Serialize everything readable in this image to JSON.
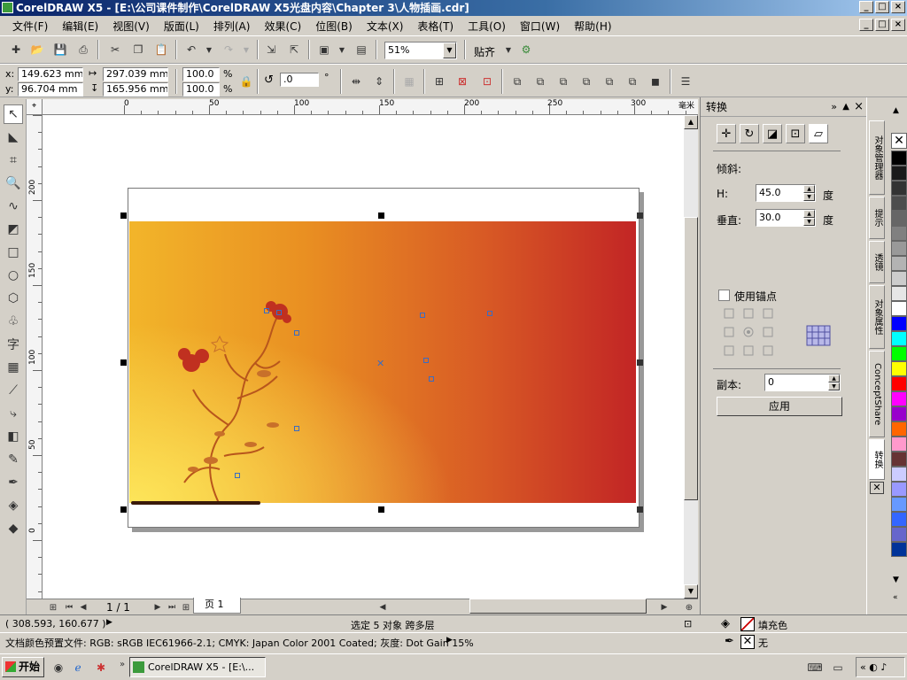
{
  "window": {
    "title": "CorelDRAW X5 - [E:\\公司课件制作\\CorelDRAW X5光盘内容\\Chapter 3\\人物插画.cdr]",
    "min": "_",
    "max": "□",
    "close": "×"
  },
  "menu": [
    "文件(F)",
    "编辑(E)",
    "视图(V)",
    "版面(L)",
    "排列(A)",
    "效果(C)",
    "位图(B)",
    "文本(X)",
    "表格(T)",
    "工具(O)",
    "窗口(W)",
    "帮助(H)"
  ],
  "toolbar": {
    "zoom": "51%",
    "snap_label": "贴齐"
  },
  "props": {
    "x_label": "x:",
    "x": "149.623 mm",
    "y_label": "y:",
    "y": "96.704 mm",
    "w": "297.039 mm",
    "h": "165.956 mm",
    "scale_w": "100.0",
    "scale_h": "100.0",
    "pct": "%",
    "rotate": ".0",
    "deg": "°"
  },
  "ruler": {
    "h": [
      "0",
      "50",
      "100",
      "150",
      "200",
      "250",
      "300"
    ],
    "v": [
      "200",
      "150",
      "100",
      "50",
      "0"
    ],
    "unit": "毫米"
  },
  "docker": {
    "title": "转换",
    "skew_label": "倾斜:",
    "h_label": "H:",
    "h_value": "45.0",
    "h_unit": "度",
    "v_label": "垂直:",
    "v_value": "30.0",
    "v_unit": "度",
    "anchor_label": "使用锚点",
    "copies_label": "副本:",
    "copies_value": "0",
    "apply_label": "应用"
  },
  "sidetabs": [
    "对象管理器",
    "提示",
    "透镜",
    "对象属性",
    "ConceptShare",
    "转换"
  ],
  "page_nav": {
    "count": "1 / 1",
    "tab": "页 1"
  },
  "status": {
    "coords": "( 308.593, 160.677 )",
    "selection": "选定 5 对象 跨多层",
    "fill_label": "填充色",
    "outline_label": "无",
    "profile": "文档颜色预置文件: RGB: sRGB IEC61966-2.1; CMYK: Japan Color 2001 Coated; 灰度: Dot Gain 15%"
  },
  "taskbar": {
    "start": "开始",
    "task": "CorelDRAW X5 - [E:\\..."
  },
  "palette": [
    "#ffffff",
    "#000000",
    "#1a1a1a",
    "#333333",
    "#4d4d4d",
    "#666666",
    "#808080",
    "#999999",
    "#b3b3b3",
    "#cccccc",
    "#e6e6e6",
    "#ffffff",
    "#0000ff",
    "#00ffff",
    "#00ff00",
    "#ffff00",
    "#ff0000",
    "#ff00ff",
    "#9900cc",
    "#ff6600",
    "#ff99cc",
    "#663333",
    "#ccccff",
    "#9999ff",
    "#6699ff",
    "#3366ff",
    "#6666cc",
    "#003399"
  ]
}
